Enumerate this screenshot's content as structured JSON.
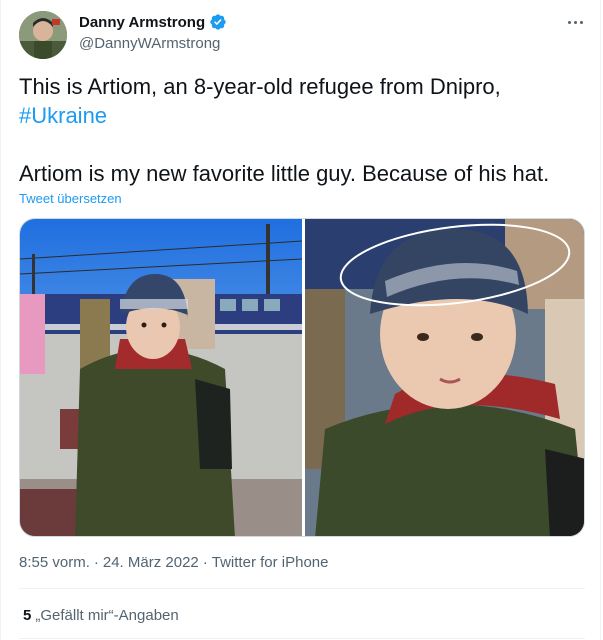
{
  "author": {
    "display_name": "Danny Armstrong",
    "handle": "@DannyWArmstrong",
    "verified_icon": "verified-badge-icon"
  },
  "tweet": {
    "line1": "This is Artiom, an 8-year-old refugee from Dnipro,",
    "hashtag": "#Ukraine",
    "line2": "Artiom is my new favorite little guy. Because of his hat.",
    "translate_label": "Tweet übersetzen"
  },
  "meta": {
    "time": "8:55 vorm.",
    "sep1": "·",
    "date": "24. März 2022",
    "sep2": "·",
    "source": "Twitter for iPhone"
  },
  "likes": {
    "count": "5",
    "label": "„Gefällt mir“-Angaben"
  },
  "colors": {
    "accent": "#1d9bf0",
    "text": "#0f1419",
    "secondary": "#536471"
  }
}
